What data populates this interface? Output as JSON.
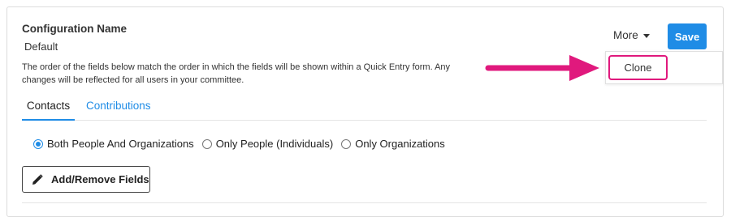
{
  "config": {
    "label": "Configuration Name",
    "value": "Default",
    "description": "The order of the fields below match the order in which the fields will be shown within a Quick Entry form. Any changes will be reflected for all users in your committee."
  },
  "header": {
    "more_label": "More",
    "save_label": "Save"
  },
  "dropdown": {
    "items": [
      {
        "label": "Clone"
      }
    ]
  },
  "tabs": [
    {
      "label": "Contacts",
      "active": true
    },
    {
      "label": "Contributions",
      "active": false
    }
  ],
  "filter": {
    "options": [
      {
        "label": "Both People And Organizations",
        "checked": true
      },
      {
        "label": "Only People (Individuals)",
        "checked": false
      },
      {
        "label": "Only Organizations",
        "checked": false
      }
    ]
  },
  "actions": {
    "add_remove_label": "Add/Remove Fields"
  },
  "colors": {
    "accent": "#1f8ce6",
    "highlight": "#e0197d"
  },
  "icons": {
    "caret": "caret-down-icon",
    "pencil": "pencil-icon",
    "arrow": "arrow-right-icon"
  }
}
